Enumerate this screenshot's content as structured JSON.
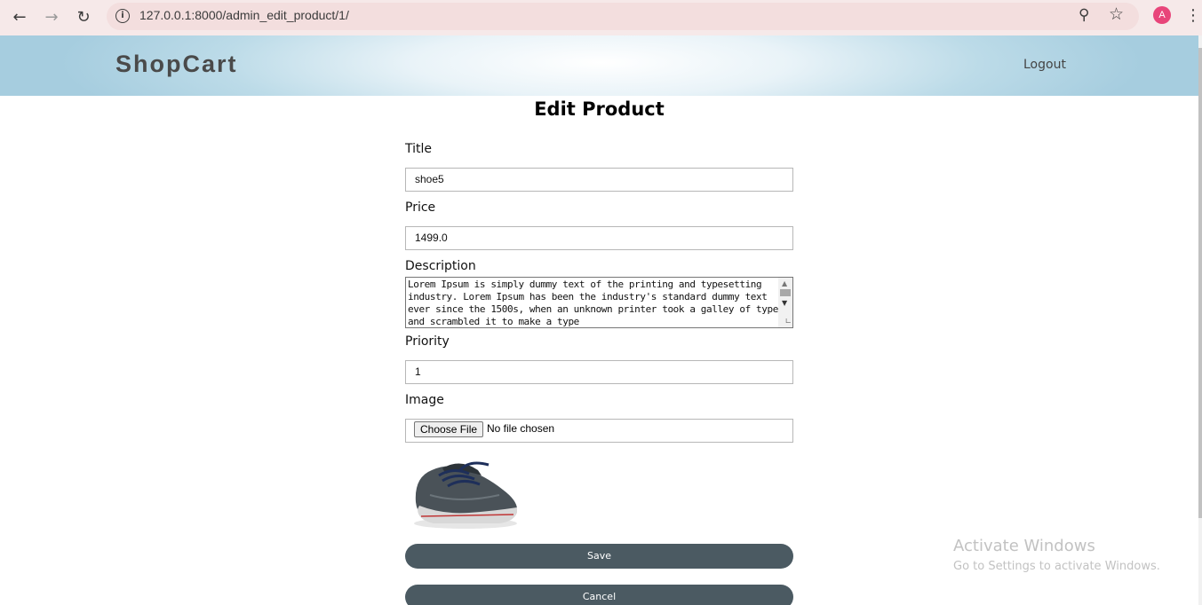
{
  "browser": {
    "url": "127.0.0.1:8000/admin_edit_product/1/",
    "profile_initial": "A",
    "icons": [
      "back-arrow-icon",
      "forward-arrow-icon",
      "reload-icon",
      "info-icon",
      "zoom-icon",
      "star-icon",
      "more-vert-icon"
    ]
  },
  "header": {
    "brand": "ShopCart",
    "logout_label": "Logout"
  },
  "form": {
    "title": "Edit Product",
    "title_label": "Title",
    "title_value": "shoe5",
    "price_label": "Price",
    "price_value": "1499.0",
    "description_label": "Description",
    "description_value": "Lorem Ipsum is simply dummy text of the printing and typesetting industry. Lorem Ipsum has been the industry's standard dummy text ever since the 1500s, when an unknown printer took a galley of type and scrambled it to make a type",
    "priority_label": "Priority",
    "priority_value": "1",
    "image_label": "Image",
    "choose_file_label": "Choose File",
    "file_status": "No file chosen",
    "save_label": "Save",
    "cancel_label": "Cancel"
  },
  "watermark": {
    "line1": "Activate Windows",
    "line2": "Go to Settings to activate Windows."
  },
  "colors": {
    "button_bg": "#4b5a62",
    "header_edge": "#a6cddf",
    "chrome_bg": "#f6e9e9",
    "avatar": "#e8457a"
  }
}
